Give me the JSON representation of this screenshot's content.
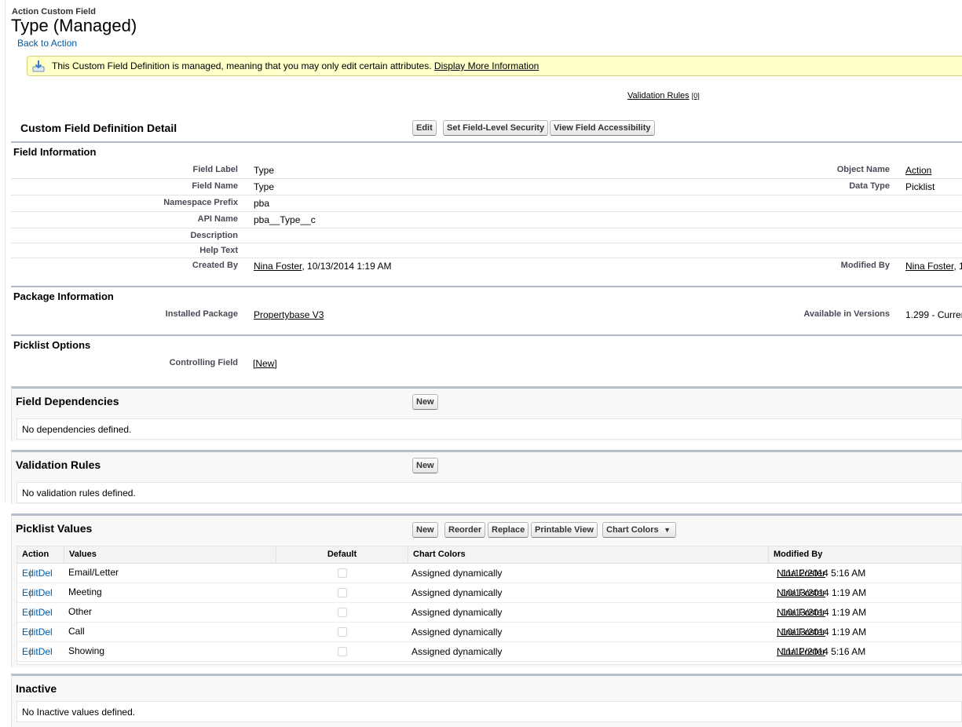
{
  "header": {
    "subtitle": "Action Custom Field",
    "title": "Type (Managed)",
    "back_link": "Back to Action"
  },
  "notice": {
    "text": "This Custom Field Definition is managed, meaning that you may only edit certain attributes.",
    "link": "Display More Information"
  },
  "related_links": {
    "validation_rules": "Validation Rules",
    "validation_rules_count": "[0]"
  },
  "detail": {
    "title": "Custom Field Definition Detail",
    "buttons": {
      "edit": "Edit",
      "set_fls": "Set Field-Level Security",
      "view_access": "View Field Accessibility"
    }
  },
  "field_info": {
    "title": "Field Information",
    "rows": {
      "field_label": {
        "label": "Field Label",
        "value": "Type"
      },
      "field_name": {
        "label": "Field Name",
        "value": "Type"
      },
      "namespace_prefix": {
        "label": "Namespace Prefix",
        "value": "pba"
      },
      "api_name": {
        "label": "API Name",
        "value": "pba__Type__c"
      },
      "description": {
        "label": "Description",
        "value": ""
      },
      "help_text": {
        "label": "Help Text",
        "value": ""
      },
      "created_by": {
        "label": "Created By",
        "user": "Nina Foster",
        "date": ", 10/13/2014 1:19 AM"
      },
      "object_name": {
        "label": "Object Name",
        "value": "Action"
      },
      "data_type": {
        "label": "Data Type",
        "value": "Picklist"
      },
      "modified_by": {
        "label": "Modified By",
        "user": "Nina Foster",
        "date": ", 1"
      }
    }
  },
  "package_info": {
    "title": "Package Information",
    "installed_package": {
      "label": "Installed Package",
      "value": "Propertybase V3"
    },
    "available_versions": {
      "label": "Available in Versions",
      "value": "1.299 - Curren"
    }
  },
  "picklist_options": {
    "title": "Picklist Options",
    "controlling_field": {
      "label": "Controlling Field",
      "value": "[New]"
    }
  },
  "field_dependencies": {
    "title": "Field Dependencies",
    "new_button": "New",
    "empty": "No dependencies defined."
  },
  "validation_rules": {
    "title": "Validation Rules",
    "new_button": "New",
    "empty": "No validation rules defined."
  },
  "picklist_values": {
    "title": "Picklist Values",
    "buttons": {
      "new": "New",
      "reorder": "Reorder",
      "replace": "Replace",
      "printable": "Printable View",
      "chart_colors": "Chart Colors"
    },
    "columns": {
      "action": "Action",
      "values": "Values",
      "default": "Default",
      "chart_colors": "Chart Colors",
      "modified_by": "Modified By"
    },
    "edit_label": "Edit",
    "del_label": "Del",
    "rows": [
      {
        "value": "Email/Letter",
        "chart_color": "Assigned dynamically",
        "user": "Nina Foster",
        "date": ", 11/12/2014 5:16 AM"
      },
      {
        "value": "Meeting",
        "chart_color": "Assigned dynamically",
        "user": "Nina Foster",
        "date": ", 10/13/2014 1:19 AM"
      },
      {
        "value": "Other",
        "chart_color": "Assigned dynamically",
        "user": "Nina Foster",
        "date": ", 10/13/2014 1:19 AM"
      },
      {
        "value": "Call",
        "chart_color": "Assigned dynamically",
        "user": "Nina Foster",
        "date": ", 10/13/2014 1:19 AM"
      },
      {
        "value": "Showing",
        "chart_color": "Assigned dynamically",
        "user": "Nina Foster",
        "date": ", 11/12/2014 5:16 AM"
      }
    ]
  },
  "inactive": {
    "title": "Inactive",
    "empty": "No Inactive values defined."
  }
}
